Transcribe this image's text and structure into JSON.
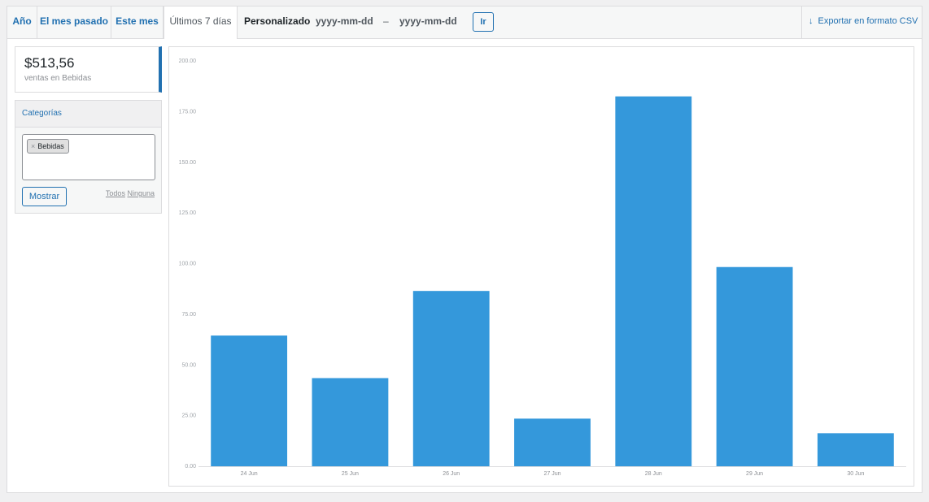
{
  "tabs": {
    "year": "Año",
    "last_month": "El mes pasado",
    "this_month": "Este mes",
    "last_7_days": "Últimos 7 días",
    "custom": "Personalizado"
  },
  "date_range": {
    "start_placeholder": "yyyy-mm-dd",
    "separator": "–",
    "end_placeholder": "yyyy-mm-dd",
    "go_label": "Ir"
  },
  "export": {
    "icon": "download-arrow-icon",
    "label": "Exportar en formato CSV"
  },
  "summary": {
    "amount": "$513,56",
    "label": "ventas en Bebidas"
  },
  "categories": {
    "title": "Categorías",
    "selected_chip": "Bebidas",
    "chip_remove": "×",
    "show_button": "Mostrar",
    "all_link": "Todos",
    "none_link": "Ninguna"
  },
  "colors": {
    "accent": "#2271b1",
    "bar": "#3498db"
  },
  "chart_data": {
    "type": "bar",
    "categories": [
      "24 Jun",
      "25 Jun",
      "26 Jun",
      "27 Jun",
      "28 Jun",
      "29 Jun",
      "30 Jun"
    ],
    "values": [
      64.5,
      43.5,
      86.5,
      23.5,
      182.5,
      98.3,
      16.3
    ],
    "ylim": [
      0,
      200
    ],
    "yticks": [
      "0.00",
      "25.00",
      "50.00",
      "75.00",
      "100.00",
      "125.00",
      "150.00",
      "175.00",
      "200.00"
    ],
    "grid": false
  }
}
